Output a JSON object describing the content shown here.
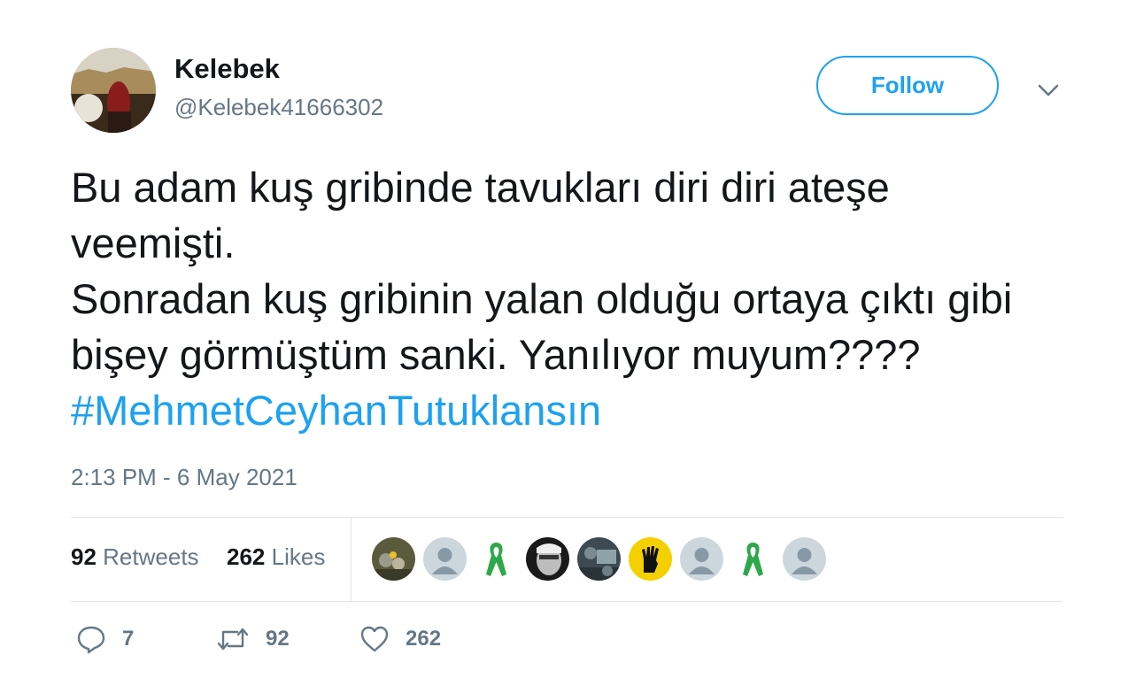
{
  "user": {
    "display_name": "Kelebek",
    "handle": "@Kelebek41666302"
  },
  "follow_label": "Follow",
  "tweet": {
    "text": "Bu adam kuş gribinde tavukları diri diri ateşe veemişti.\nSonradan kuş gribinin yalan olduğu ortaya çıktı gibi bişey görmüştüm sanki. Yanılıyor muyum???? ",
    "hashtag": "#MehmetCeyhanTutuklansın",
    "timestamp": "2:13 PM - 6 May 2021"
  },
  "stats": {
    "retweets_count": "92",
    "retweets_label": "Retweets",
    "likes_count": "262",
    "likes_label": "Likes"
  },
  "likers": [
    "photo-avatar",
    "default-avatar",
    "green-ribbon-avatar",
    "bw-photo-avatar",
    "photo-avatar",
    "rabia-hand-avatar",
    "default-avatar",
    "green-ribbon-avatar",
    "default-avatar"
  ],
  "actions": {
    "replies": "7",
    "retweets": "92",
    "likes": "262"
  },
  "colors": {
    "accent": "#1da1f2",
    "text": "#14171a",
    "muted": "#657786",
    "divider": "#e1e8ed"
  }
}
